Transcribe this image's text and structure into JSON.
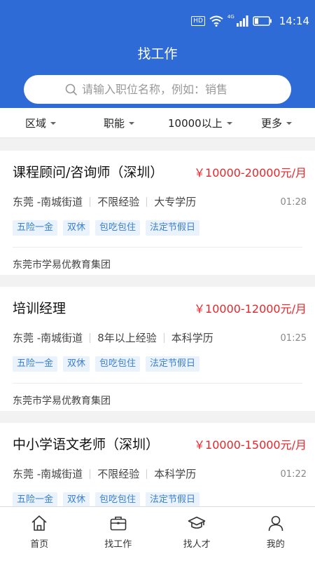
{
  "status_bar": {
    "hd": "HD",
    "network": "4G",
    "time": "14:14"
  },
  "header": {
    "title": "找工作"
  },
  "search": {
    "placeholder": "请输入职位名称，例如：销售",
    "icon": "search-icon"
  },
  "filters": [
    {
      "label": "区域"
    },
    {
      "label": "职能"
    },
    {
      "label": "10000以上"
    },
    {
      "label": "更多"
    }
  ],
  "jobs": [
    {
      "title": "课程顾问/咨询师（深圳）",
      "salary": "￥10000-20000元/月",
      "location": "东莞 -南城街道",
      "experience": "不限经验",
      "education": "大专学历",
      "time": "01:28",
      "tags": [
        "五险一金",
        "双休",
        "包吃包住",
        "法定节假日"
      ],
      "company": "东莞市学易优教育集团"
    },
    {
      "title": "培训经理",
      "salary": "￥10000-12000元/月",
      "location": "东莞 -南城街道",
      "experience": "8年以上经验",
      "education": "本科学历",
      "time": "01:25",
      "tags": [
        "五险一金",
        "双休",
        "包吃包住",
        "法定节假日"
      ],
      "company": "东莞市学易优教育集团"
    },
    {
      "title": "中小学语文老师（深圳）",
      "salary": "￥10000-15000元/月",
      "location": "东莞 -南城街道",
      "experience": "不限经验",
      "education": "本科学历",
      "time": "01:22",
      "tags": [
        "五险一金",
        "双休",
        "包吃包住",
        "法定节假日"
      ],
      "company": ""
    }
  ],
  "tab_bar": [
    {
      "label": "首页",
      "icon": "home-icon"
    },
    {
      "label": "找工作",
      "icon": "briefcase-icon"
    },
    {
      "label": "找人才",
      "icon": "graduation-cap-icon"
    },
    {
      "label": "我的",
      "icon": "user-icon"
    }
  ],
  "colors": {
    "primary": "#2f6bd6",
    "salary": "#e8272c",
    "tag_text": "#3a7fd1",
    "tag_bg": "#eaf3fb"
  }
}
